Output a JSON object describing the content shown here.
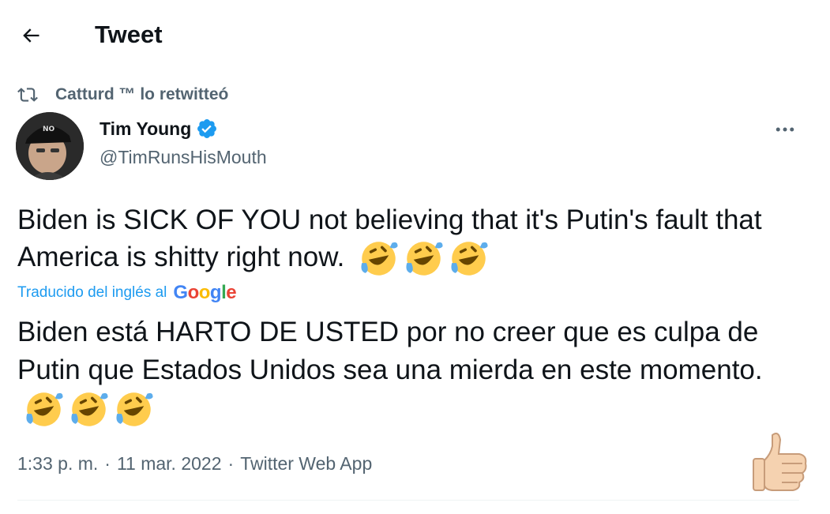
{
  "header": {
    "title": "Tweet",
    "back_icon": "arrow-left-icon"
  },
  "retweet": {
    "text": "Catturd ™ lo retwitteó",
    "icon": "retweet-icon"
  },
  "author": {
    "name": "Tim Young",
    "handle": "@TimRunsHisMouth",
    "verified": true,
    "verified_color": "#1d9bf0",
    "avatar_cap_text": "NO"
  },
  "tweet": {
    "text": "Biden is SICK OF YOU not believing that it's Putin's fault that America is shitty right now.",
    "emoji": [
      "rolling-on-floor-laughing-emoji",
      "rolling-on-floor-laughing-emoji",
      "rolling-on-floor-laughing-emoji"
    ]
  },
  "translation": {
    "label": "Traducido del inglés al",
    "provider": "Google",
    "text": "Biden está HARTO DE USTED por no creer que es culpa de Putin que Estados Unidos sea una mierda en este momento."
  },
  "meta": {
    "time": "1:33 p. m.",
    "separator": "·",
    "date": "11 mar. 2022",
    "source": "Twitter Web App"
  },
  "colors": {
    "text_primary": "#0f1419",
    "text_secondary": "#536471",
    "accent": "#1d9bf0"
  }
}
